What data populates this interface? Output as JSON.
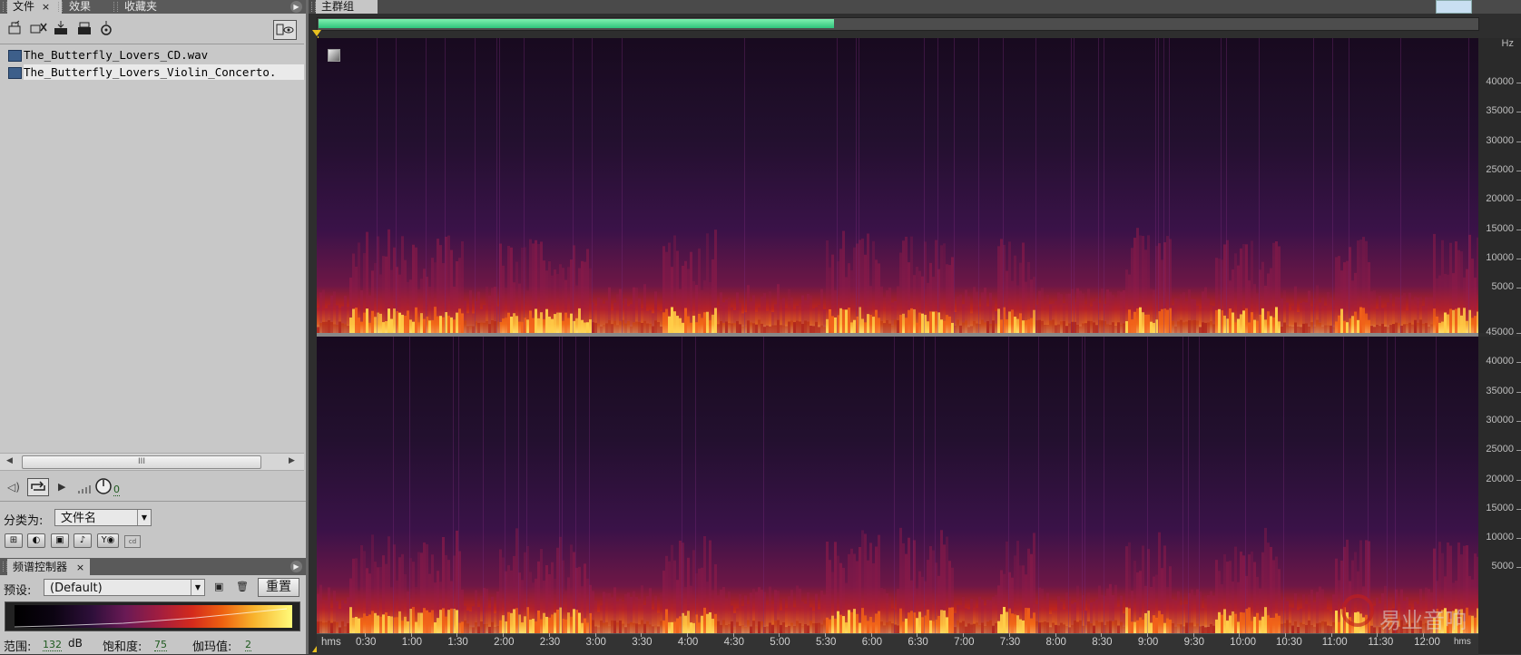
{
  "left_panel": {
    "tabs": [
      {
        "label": "文件",
        "closable": true,
        "active": true
      },
      {
        "label": "效果"
      },
      {
        "label": "收藏夹"
      }
    ],
    "close_glyph": "×",
    "files": [
      "The_Butterfly_Lovers_CD.wav",
      "The_Butterfly_Lovers_Violin_Concerto."
    ],
    "scroll_thumb_glyph": "III",
    "playback_value": "0",
    "sort_label": "分类为:",
    "sort_value": "文件名",
    "spectral_panel": {
      "title": "频谱控制器",
      "preset_label": "预设:",
      "preset_value": "(Default)",
      "reset_label": "重置",
      "range_label": "范围:",
      "range_value": "132",
      "range_unit": "dB",
      "saturation_label": "饱和度:",
      "saturation_value": "75",
      "gamma_label": "伽玛值:",
      "gamma_value": "2"
    }
  },
  "editor": {
    "tab_label": "主群组",
    "hz_unit": "Hz",
    "hz_labels_top": [
      "40000",
      "35000",
      "30000",
      "25000",
      "20000",
      "15000",
      "10000",
      "5000"
    ],
    "hz_labels_bottom": [
      "45000",
      "40000",
      "35000",
      "30000",
      "25000",
      "20000",
      "15000",
      "10000",
      "5000"
    ],
    "time_unit_left": "hms",
    "time_unit_right": "hms",
    "time_labels": [
      "0:30",
      "1:00",
      "1:30",
      "2:00",
      "2:30",
      "3:00",
      "3:30",
      "4:00",
      "4:30",
      "5:00",
      "5:30",
      "6:00",
      "6:30",
      "7:00",
      "7:30",
      "8:00",
      "8:30",
      "9:00",
      "9:30",
      "10:00",
      "10:30",
      "11:00",
      "11:30",
      "12:00"
    ],
    "overview_fraction": 0.445
  },
  "watermark": {
    "text": "易业音响"
  },
  "colors": {
    "overview_fill": "#2fc47c",
    "spectrum_low": "#1a0c22",
    "spectrum_high": "#fffb7a",
    "playhead_marker": "#e8c020"
  }
}
